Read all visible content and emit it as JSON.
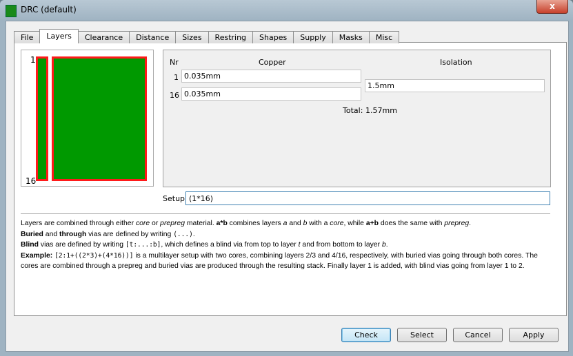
{
  "window": {
    "title": "DRC (default)",
    "close_label": "x"
  },
  "tabs": [
    "File",
    "Layers",
    "Clearance",
    "Distance",
    "Sizes",
    "Restring",
    "Shapes",
    "Supply",
    "Masks",
    "Misc"
  ],
  "active_tab": "Layers",
  "preview": {
    "top_layer": "1",
    "bottom_layer": "16",
    "copper_color": "#009900",
    "edge_color": "#ff1a1a"
  },
  "layers": {
    "col_nr": "Nr",
    "col_copper": "Copper",
    "col_isolation": "Isolation",
    "rows": [
      {
        "nr": "1",
        "copper": "0.035mm"
      },
      {
        "nr": "16",
        "copper": "0.035mm"
      }
    ],
    "isolation": "1.5mm",
    "total_label": "Total:",
    "total_value": "1.57mm"
  },
  "setup": {
    "label": "Setup",
    "value": "(1*16)"
  },
  "help": {
    "l1": [
      "Layers are combined through either ",
      "core",
      " or ",
      "prepreg",
      " material. ",
      "a*b",
      " combines layers ",
      "a",
      " and ",
      "b",
      " with a ",
      "core",
      ", while ",
      "a+b",
      " does the same with ",
      "prepreg",
      "."
    ],
    "l2": [
      "Buried",
      " and ",
      "through",
      " vias are defined by writing ",
      "(...)",
      "."
    ],
    "l3": [
      "Blind",
      " vias are defined by writing ",
      "[t:...:b]",
      ", which defines a blind via from top to layer ",
      "t",
      " and from bottom to layer ",
      "b",
      "."
    ],
    "l4": [
      "Example:",
      " ",
      "[2:1+((2*3)+(4*16))]",
      " is a multilayer setup with two cores, combining layers 2/3 and 4/16, respectively, with buried vias going through both cores. The cores are combined through a prepreg and buried vias are produced through the resulting stack. Finally layer 1 is added, with blind vias going from layer 1 to 2."
    ]
  },
  "buttons": {
    "check": "Check",
    "select": "Select",
    "cancel": "Cancel",
    "apply": "Apply"
  }
}
